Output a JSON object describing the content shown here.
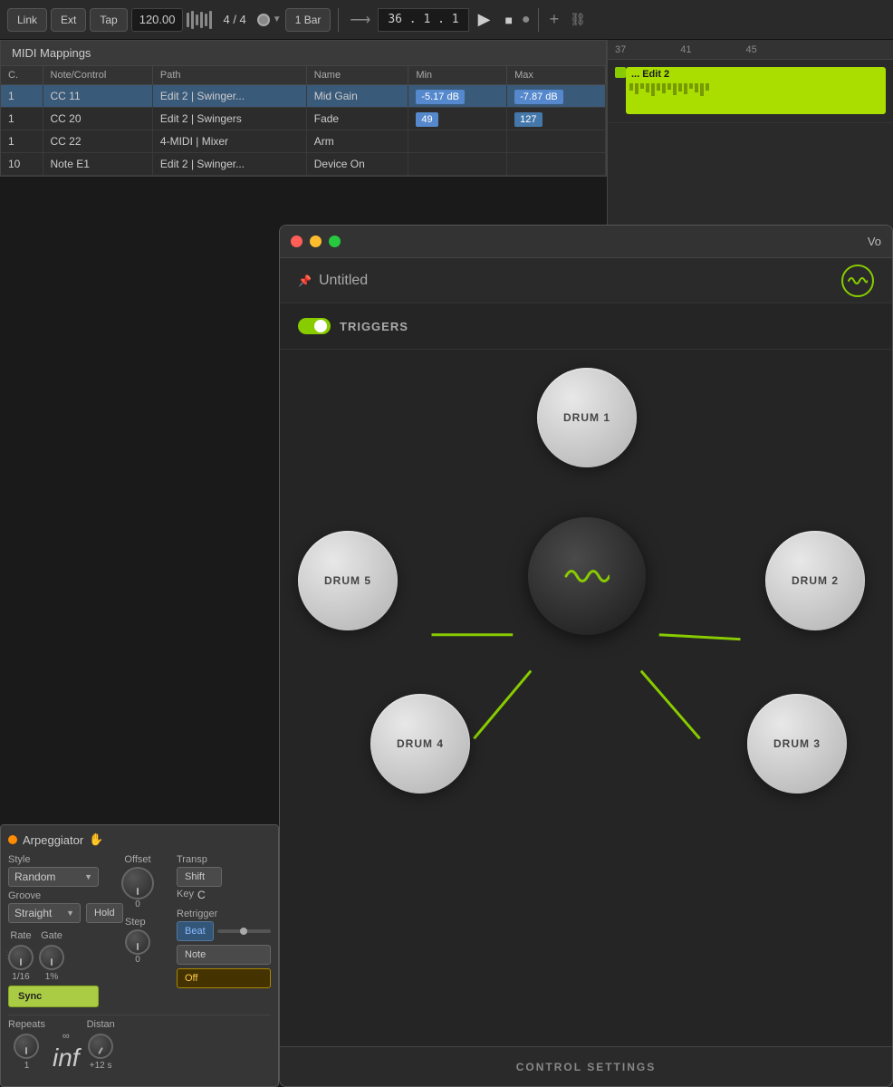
{
  "toolbar": {
    "link": "Link",
    "ext": "Ext",
    "tap": "Tap",
    "bpm": "120.00",
    "time_sig": "4 / 4",
    "bar_option": "1 Bar",
    "position": "36 .  1 .  1",
    "play": "▶",
    "stop": "■",
    "record": "●",
    "add": "+",
    "loop": "↺"
  },
  "midi": {
    "title": "MIDI Mappings",
    "columns": [
      "C.",
      "Note/Control",
      "Path",
      "Name",
      "Min",
      "Max"
    ],
    "rows": [
      {
        "ch": "1",
        "control": "CC 11",
        "path": "Edit 2 | Swinger...",
        "name": "Mid Gain",
        "min": "-5.17 dB",
        "max": "-7.87 dB",
        "highlighted": true
      },
      {
        "ch": "1",
        "control": "CC 20",
        "path": "Edit 2 | Swingers",
        "name": "Fade",
        "min": "49",
        "max": "127"
      },
      {
        "ch": "1",
        "control": "CC 22",
        "path": "4-MIDI | Mixer",
        "name": "Arm",
        "min": "",
        "max": ""
      },
      {
        "ch": "10",
        "control": "Note E1",
        "path": "Edit 2 | Swinger...",
        "name": "Device On",
        "min": "",
        "max": ""
      }
    ]
  },
  "arrange": {
    "markers": [
      "37",
      "41",
      "45"
    ],
    "clip_label": "... Edit 2"
  },
  "plugin": {
    "title": "Vo",
    "name": "Untitled",
    "triggers_label": "TRIGGERS",
    "drums": [
      "DRUM 1",
      "DRUM 2",
      "DRUM 3",
      "DRUM 4",
      "DRUM 5"
    ],
    "control_settings": "CONTROL SETTINGS"
  },
  "arp": {
    "title": "Arpeggiator",
    "style_label": "Style",
    "style_value": "Random",
    "groove_label": "Groove",
    "groove_value": "Straight",
    "hold_btn": "Hold",
    "offset_label": "Offset",
    "offset_value": "0",
    "transp_label": "Transp",
    "shift_value": "Shift",
    "key_label": "Key",
    "key_value": "C",
    "rate_label": "Rate",
    "rate_value": "1/16",
    "gate_label": "Gate",
    "gate_value": "1%",
    "steps_label": "Step",
    "steps_value": "0",
    "sync_btn": "Sync",
    "retrigger_label": "Retrigger",
    "beat_btn": "Beat",
    "note_btn": "Note",
    "off_btn": "Off",
    "repeats_label": "Repeats",
    "repeats_value": "1",
    "distance_label": "Distan",
    "distance_value": "+12 s",
    "inf_value": "inf"
  }
}
